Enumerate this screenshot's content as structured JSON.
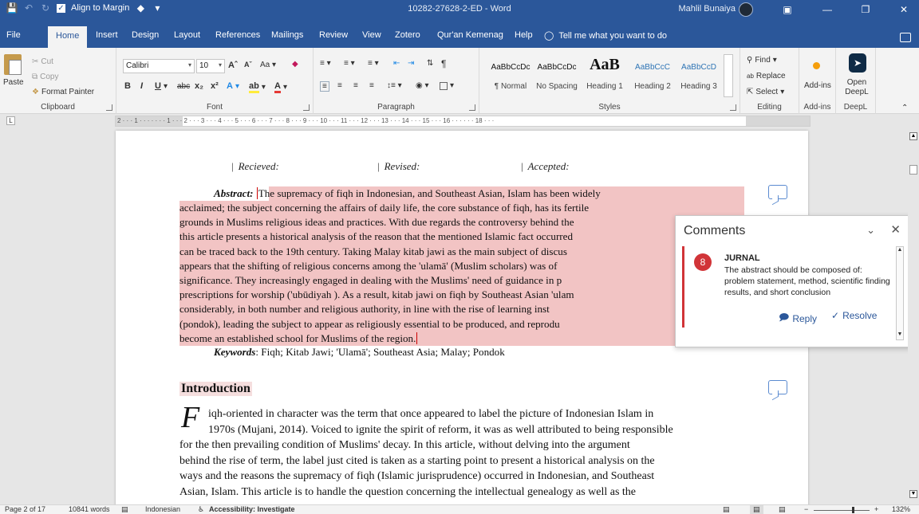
{
  "titlebar": {
    "qat_align": "Align to Margin",
    "doc_title": "10282-27628-2-ED  -  Word",
    "user": "Mahlil Bunaiya"
  },
  "tabs": [
    "File",
    "Home",
    "Insert",
    "Design",
    "Layout",
    "References",
    "Mailings",
    "Review",
    "View",
    "Zotero",
    "Qur'an Kemenag",
    "Help"
  ],
  "active_tab": "Home",
  "tellme": "Tell me what you want to do",
  "ribbon": {
    "clipboard": {
      "paste": "Paste",
      "cut": "Cut",
      "copy": "Copy",
      "format_painter": "Format Painter",
      "label": "Clipboard"
    },
    "font": {
      "name": "Calibri",
      "size": "10",
      "label": "Font"
    },
    "paragraph": {
      "label": "Paragraph"
    },
    "styles": {
      "label": "Styles",
      "items": [
        {
          "preview": "AaBbCcDc",
          "name": "¶ Normal"
        },
        {
          "preview": "AaBbCcDc",
          "name": "No Spacing"
        },
        {
          "preview": "AaB",
          "name": "Heading 1"
        },
        {
          "preview": "AaBbCcC",
          "name": "Heading 2"
        },
        {
          "preview": "AaBbCcD",
          "name": "Heading 3"
        }
      ]
    },
    "editing": {
      "find": "Find",
      "replace": "Replace",
      "select": "Select",
      "label": "Editing"
    },
    "addins": {
      "button": "Add-ins",
      "label": "Add-ins"
    },
    "deepl": {
      "button": "Open DeepL",
      "label": "DeepL"
    }
  },
  "ruler_text": "2 · · · 1 · · · ·    · · · 1 · · · 2 · · · 3 · · · 4 · · · 5 · · · 6 · · · 7 · · · 8 · · · 9 · · · 10 · · · 11 · · · 12 · · · 13 · · · 14 · · · 15 · · · 16 · · ·    · · · 18 · · ·",
  "document": {
    "received": "Recieved:",
    "revised": "Revised:",
    "accepted": "Accepted:",
    "abstract_lead": "Abstract:",
    "abstract_lines": [
      "The supremacy of fiqh in Indonesian, and Southeast Asian, Islam has been widely",
      "acclaimed; the subject concerning the affairs of daily life, the core substance of fiqh, has its fertile",
      "grounds in Muslims religious ideas and practices. With due regards the controversy behind the",
      "this article presents a historical analysis of the reason that the mentioned Islamic fact occurred",
      "can be traced back to the 19th century. Taking Malay kitab jawi as the main subject of discus",
      "appears that the shifting of religious concerns among the 'ulamā' (Muslim scholars) was of",
      "significance. They increasingly engaged in dealing with the Muslims' need of guidance in p",
      "prescriptions for worship ('ubūdiyah ). As a result, kitab jawi on fiqh by Southeast Asian 'ulam",
      "considerably, in both number and religious authority, in line with the rise of learning inst",
      "(pondok), leading the subject to appear as religiously essential to be produced, and reprodu",
      "become an established school for Muslims of the region."
    ],
    "keywords_lead": "Keywords",
    "keywords": ": Fiqh; Kitab Jawi; 'Ulamā'; Southeast Asia; Malay; Pondok",
    "heading": "Introduction",
    "dropcap": "F",
    "body_lines": [
      "iqh-oriented in character was the term that once appeared to label the picture of Indonesian Islam in",
      "1970s (Mujani, 2014). Voiced to ignite the spirit of reform, it was as well attributed to being responsible",
      "for the then prevailing condition of Muslims' decay. In this article, without delving into the argument",
      "behind the rise of term, the label just cited is taken as a starting point to present a historical analysis on the",
      "ways and the reasons the supremacy of fiqh (Islamic jurisprudence) occurred in Indonesian, and Southeast",
      "Asian, Islam. This article is to handle the question concerning the intellectual genealogy as well as the"
    ]
  },
  "comments_pane": {
    "title": "Comments",
    "author": "JURNAL",
    "avatar_initial": "8",
    "text": "The abstract should be composed of: problem statement, method, scientific finding results, and short conclusion",
    "reply": "Reply",
    "resolve": "Resolve"
  },
  "status": {
    "page": "Page 2 of 17",
    "words": "10841 words",
    "language": "Indonesian",
    "accessibility": "Accessibility: Investigate",
    "zoom": "132%"
  },
  "colors": {
    "brand": "#2b579a",
    "highlight": "#f2c4c4",
    "comment_accent": "#d13438"
  }
}
